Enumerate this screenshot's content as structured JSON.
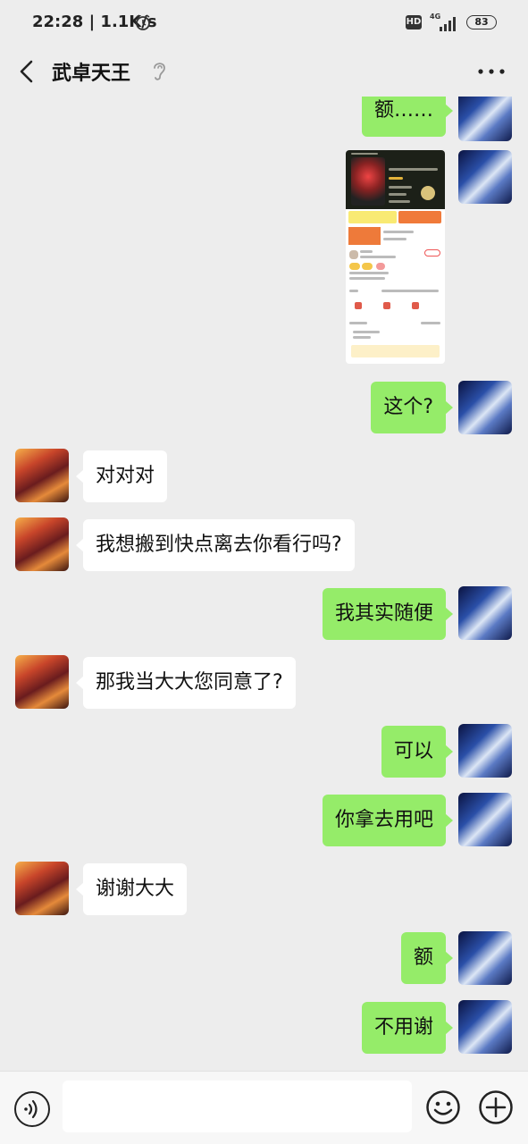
{
  "status_bar": {
    "time": "22:28",
    "speed": "1.1K/s",
    "hd": "HD",
    "network": "4G",
    "battery": "83"
  },
  "header": {
    "title": "武卓天王",
    "back_icon": "chevron-left-icon",
    "ear_icon": "ear-icon",
    "more_icon": "more-dots-icon"
  },
  "messages": [
    {
      "from": "me",
      "text": "额……"
    },
    {
      "from": "me",
      "type": "image",
      "content": "screenshot"
    },
    {
      "from": "me",
      "text": "这个?"
    },
    {
      "from": "them",
      "text": "对对对"
    },
    {
      "from": "them",
      "text": "我想搬到快点离去你看行吗?"
    },
    {
      "from": "me",
      "text": "我其实随便"
    },
    {
      "from": "them",
      "text": "那我当大大您同意了?"
    },
    {
      "from": "me",
      "text": "可以"
    },
    {
      "from": "me",
      "text": "你拿去用吧"
    },
    {
      "from": "them",
      "text": "谢谢大大"
    },
    {
      "from": "me",
      "text": "额"
    },
    {
      "from": "me",
      "text": "不用谢"
    }
  ],
  "input_bar": {
    "voice_icon": "voice-icon",
    "emoji_icon": "emoji-icon",
    "plus_icon": "plus-icon",
    "input_value": ""
  },
  "colors": {
    "background": "#ededed",
    "my_bubble": "#95ec69",
    "their_bubble": "#ffffff"
  }
}
